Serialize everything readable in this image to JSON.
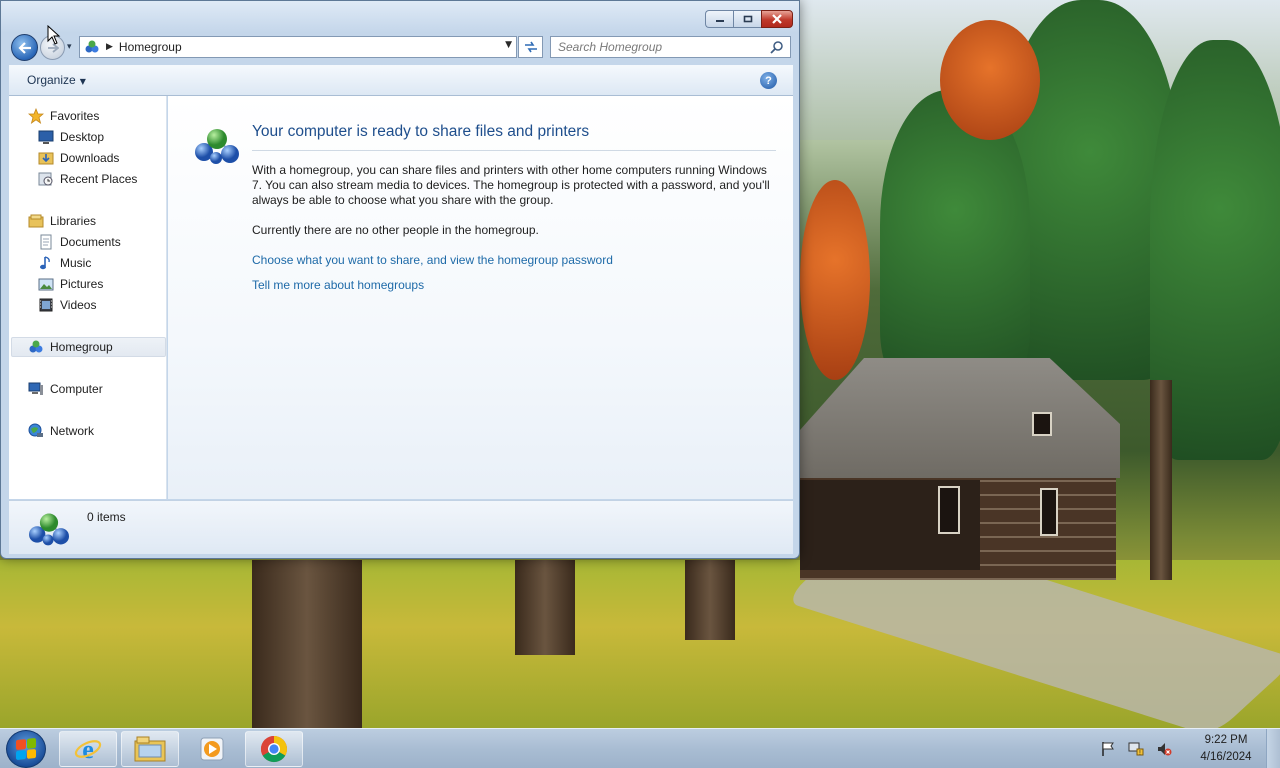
{
  "window": {
    "title": "",
    "caption_buttons": {
      "minimize": "minimize",
      "maximize": "maximize",
      "close": "close"
    }
  },
  "navbar": {
    "breadcrumb": "Homegroup",
    "search_placeholder": "Search Homegroup"
  },
  "toolbar": {
    "organize_label": "Organize",
    "help_label": "?"
  },
  "nav_pane": {
    "favorites": {
      "label": "Favorites",
      "items": [
        "Desktop",
        "Downloads",
        "Recent Places"
      ]
    },
    "libraries": {
      "label": "Libraries",
      "items": [
        "Documents",
        "Music",
        "Pictures",
        "Videos"
      ]
    },
    "homegroup": "Homegroup",
    "computer": "Computer",
    "network": "Network"
  },
  "content": {
    "heading": "Your computer is ready to share files and printers",
    "description": "With a homegroup, you can share files and printers with other home computers running Windows 7. You can also stream media to devices. The homegroup is protected with a password, and you'll always be able to choose what you share with the group.",
    "status": "Currently there are no other people in the homegroup.",
    "links": [
      "Choose what you want to share, and view the homegroup password",
      "Tell me more about homegroups"
    ]
  },
  "details": {
    "item_count": "0 items"
  },
  "taskbar": {
    "pinned": [
      "internet-explorer",
      "windows-explorer",
      "windows-media-player",
      "google-chrome"
    ],
    "time": "9:22 PM",
    "date": "4/16/2024"
  },
  "colors": {
    "link": "#1e6aa8",
    "heading": "#1e4e8c",
    "window_frame": "#c4d6ea",
    "taskbar": "#a9bdd3"
  }
}
